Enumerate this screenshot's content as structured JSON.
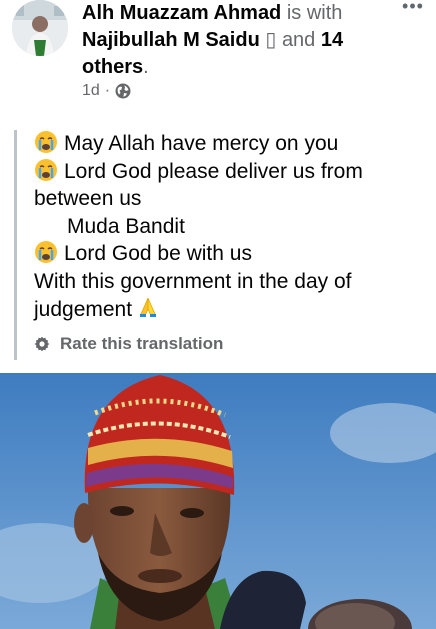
{
  "header": {
    "author_name": "Alh Muazzam Ahmad",
    "with_text": "is with",
    "tagged_name": "Najibullah M Saidu",
    "tagged_glyph": "▯",
    "and_text": "and",
    "others_count": "14 others",
    "period": ".",
    "time_ago": "1d",
    "separator": "·",
    "privacy_icon": "globe-icon",
    "more_label": "•••"
  },
  "post": {
    "lines": [
      {
        "emoji": "crying-face",
        "text": "May Allah have mercy on you"
      },
      {
        "emoji": "crying-face",
        "text": "Lord God please deliver us from"
      },
      {
        "emoji": "",
        "text": "between us"
      },
      {
        "emoji": "",
        "text": "Muda Bandit"
      },
      {
        "emoji": "crying-face",
        "text": "Lord God be with us"
      },
      {
        "emoji": "",
        "text": "With this government in the day of"
      },
      {
        "emoji": "",
        "text": "judgement",
        "trailing_emoji": "folded-hands"
      }
    ],
    "rate_translation_label": "Rate this translation",
    "rate_icon": "gear-icon"
  },
  "colors": {
    "text_primary": "#050505",
    "text_secondary": "#65676b",
    "quote_bar": "#bec3c9",
    "sky": "#5f8fc4"
  }
}
